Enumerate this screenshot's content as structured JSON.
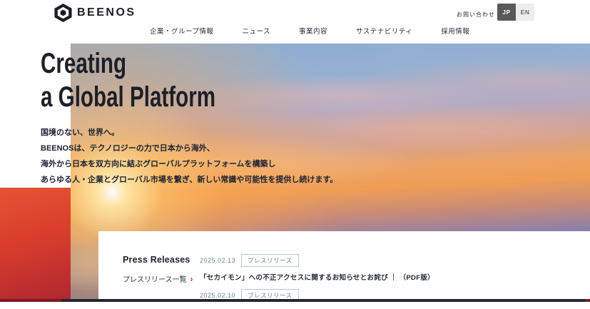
{
  "header": {
    "logo_text": "BEENOS",
    "contact_label": "お問い合わせ",
    "nav": [
      {
        "label": "企業・グループ情報"
      },
      {
        "label": "ニュース"
      },
      {
        "label": "事業内容"
      },
      {
        "label": "サステナビリティ"
      },
      {
        "label": "採用情報"
      }
    ],
    "lang_switch": {
      "jp_label": "JP",
      "en_label": "EN",
      "active": "JP"
    }
  },
  "hero": {
    "title_line1": "Creating",
    "title_line2": "a Global Platform",
    "body_lines": [
      "国境のない、世界へ。",
      "BEENOSは、テクノロジーの力で日本から海外、",
      "海外から日本を双方向に結ぶグローバルプラットフォームを構築し",
      "あらゆる人・企業とグローバル市場を繋ぎ、新しい常識や可能性を提供し続けます。"
    ]
  },
  "news": {
    "heading": "Press Releases",
    "list_link_label": "プレスリリース一覧",
    "items": [
      {
        "date": "2025.02.13",
        "badge": "プレスリリース",
        "title": "「セカイモン」への不正アクセスに関するお知らせとお詫び ｜ （PDF版）"
      },
      {
        "date": "2025.02.10",
        "badge": "プレスリリース",
        "title": ""
      }
    ]
  },
  "icons": {
    "chevron_right": "›"
  },
  "colors": {
    "accent_red": "#d0392c",
    "dark_navy": "#1d2230",
    "badge_teal": "#6b8591",
    "lang_active_bg": "#595959"
  }
}
